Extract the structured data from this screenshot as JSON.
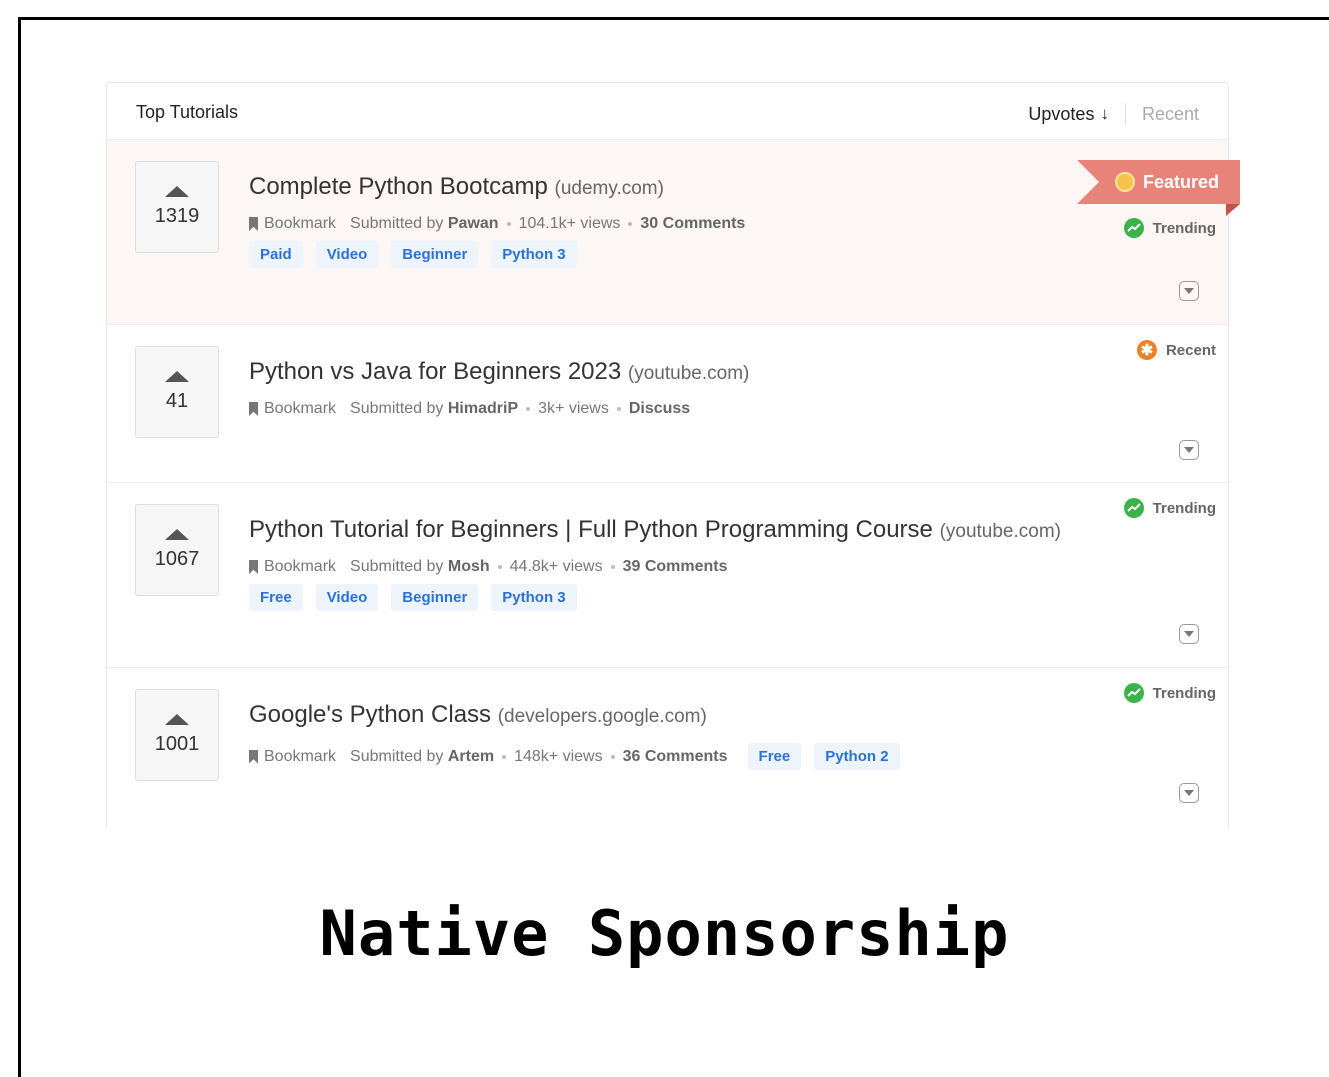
{
  "panel": {
    "title": "Top Tutorials",
    "sort": {
      "upvotes_label": "Upvotes",
      "sort_arrow": "↓",
      "recent_label": "Recent"
    }
  },
  "featured_label": "Featured",
  "bookmark_label": "Bookmark",
  "submitted_by_label": "Submitted by",
  "tutorials": [
    {
      "votes": "1319",
      "title": "Complete Python Bootcamp",
      "domain": "(udemy.com)",
      "author": "Pawan",
      "views": "104.1k+ views",
      "comments": "30 Comments",
      "tags": [
        "Paid",
        "Video",
        "Beginner",
        "Python 3"
      ],
      "status": "Trending",
      "featured": true
    },
    {
      "votes": "41",
      "title": "Python vs Java for Beginners 2023",
      "domain": "(youtube.com)",
      "author": "HimadriP",
      "views": "3k+ views",
      "comments": "Discuss",
      "tags": [],
      "status": "Recent"
    },
    {
      "votes": "1067",
      "title": "Python Tutorial for Beginners | Full Python Programming Course",
      "domain": "(youtube.com)",
      "author": "Mosh",
      "views": "44.8k+ views",
      "comments": "39 Comments",
      "tags": [
        "Free",
        "Video",
        "Beginner",
        "Python 3"
      ],
      "status": "Trending"
    },
    {
      "votes": "1001",
      "title": "Google's Python Class",
      "domain": "(developers.google.com)",
      "author": "Artem",
      "views": "148k+ views",
      "comments": "36 Comments",
      "tags": [
        "Free",
        "Python 2"
      ],
      "status": "Trending"
    }
  ],
  "headline": "Native Sponsorship",
  "colors": {
    "featured_bg": "#fcf6f4",
    "ribbon": "#e8837a",
    "tag_text": "#2a72d8",
    "trending": "#3cb34a",
    "recent": "#e9822b"
  }
}
